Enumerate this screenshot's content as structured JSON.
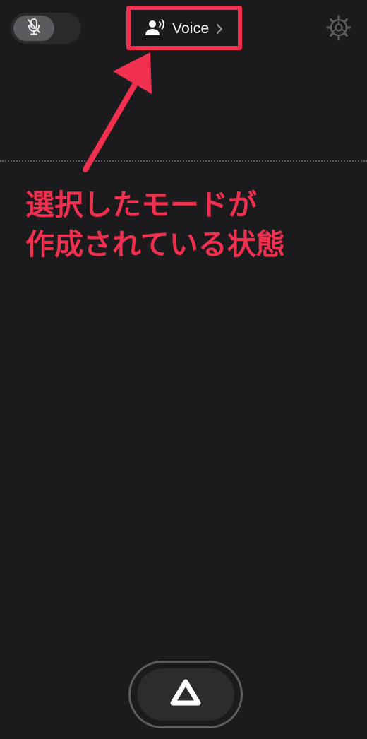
{
  "header": {
    "mode_label": "Voice",
    "mode_icon": "person-speaking-icon",
    "chevron_icon": "chevron-right-icon",
    "mic_icon": "mic-off-icon",
    "settings_icon": "gear-icon"
  },
  "annotation": {
    "line1": "選択したモードが",
    "line2": "作成されている状態",
    "color": "#f0304e"
  },
  "footer": {
    "start_icon": "triangle-icon"
  },
  "colors": {
    "background": "#1b1b1d",
    "accent": "#f0304e",
    "toggle_bg": "#2a2a2d",
    "knob": "#5b5b5f"
  }
}
